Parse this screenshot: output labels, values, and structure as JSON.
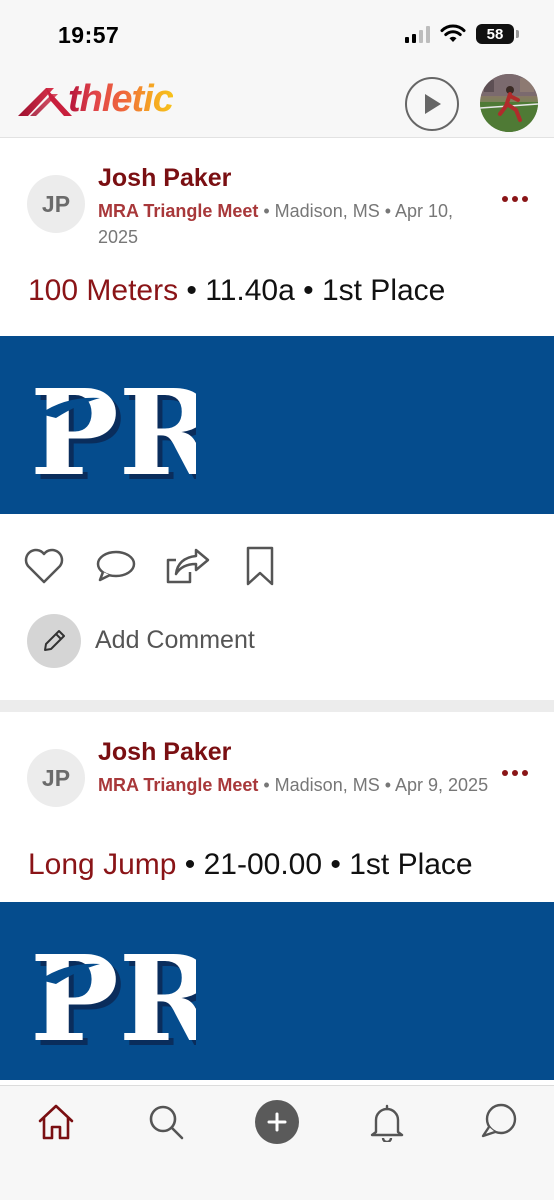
{
  "status_bar": {
    "time": "19:57",
    "battery": "58"
  },
  "header": {
    "logo_text": "thletic",
    "icons": [
      "play-icon",
      "profile-avatar"
    ]
  },
  "posts": [
    {
      "initials": "JP",
      "author": "Josh Paker",
      "meet": "MRA Triangle Meet",
      "meta_rest": " • Madison, MS • Apr 10, 2025",
      "event": "100 Meters",
      "result_rest": " • 11.40a • 1st Place",
      "banner_text": "PR",
      "add_comment": "Add Comment"
    },
    {
      "initials": "JP",
      "author": "Josh Paker",
      "meet": "MRA Triangle Meet",
      "meta_rest": " • Madison, MS • Apr 9, 2025",
      "event": "Long Jump",
      "result_rest": " • 21-00.00 • 1st Place",
      "banner_text": "PR"
    }
  ],
  "tab_bar": {
    "items": [
      "home-icon",
      "search-icon",
      "add-icon",
      "notifications-icon",
      "messages-icon"
    ],
    "active": "home-icon"
  },
  "colors": {
    "brand_red": "#7a0f12",
    "banner_blue": "#054c8d",
    "meet_red": "#a8383a"
  }
}
